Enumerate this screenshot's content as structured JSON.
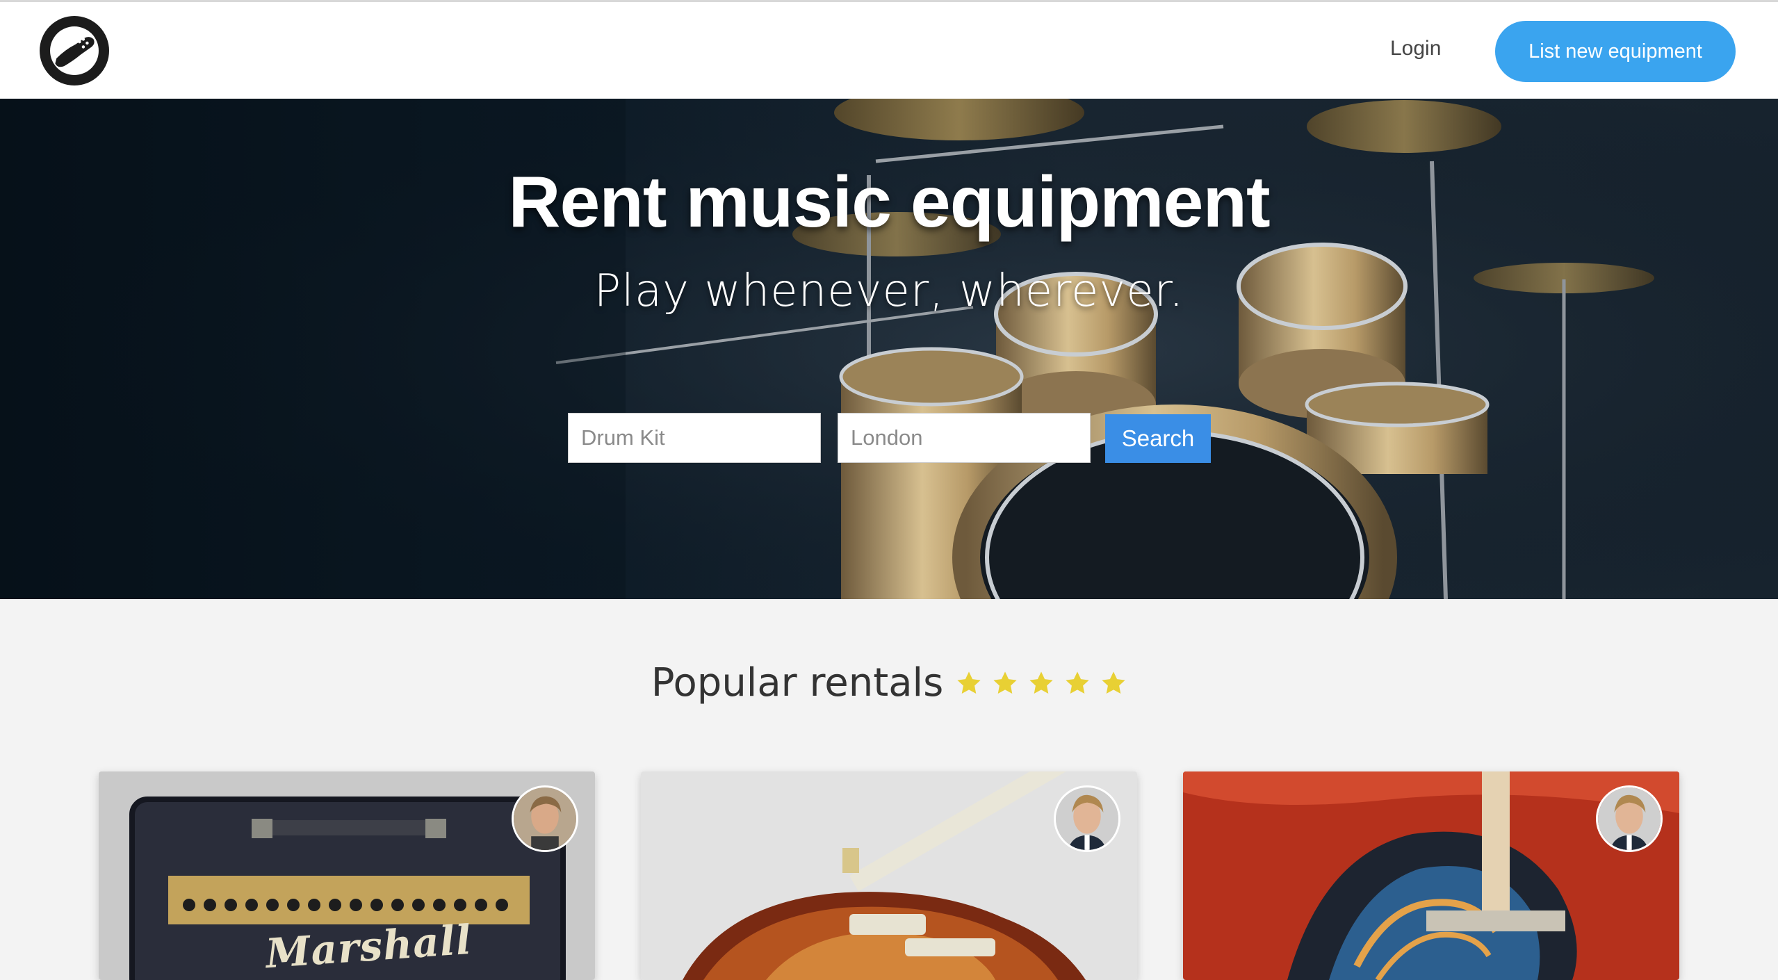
{
  "nav": {
    "login_label": "Login",
    "cta_label": "List new equipment"
  },
  "hero": {
    "title": "Rent music equipment",
    "subtitle": "Play whenever, wherever.",
    "search": {
      "what_placeholder": "Drum Kit",
      "where_placeholder": "London",
      "button_label": "Search"
    }
  },
  "popular": {
    "heading": "Popular rentals",
    "star_count": 5,
    "listings": [
      {
        "brand_text": "Marshall",
        "image_icon": "guitar-amplifier-image"
      },
      {
        "image_icon": "electric-guitar-image"
      },
      {
        "image_icon": "electric-guitar-flames-image"
      }
    ]
  },
  "colors": {
    "brand_blue": "#3aa4ef",
    "search_blue": "#3a8ee6",
    "star_yellow": "#e8d034",
    "hero_dark": "#0e1c28",
    "section_bg": "#f3f3f3"
  }
}
